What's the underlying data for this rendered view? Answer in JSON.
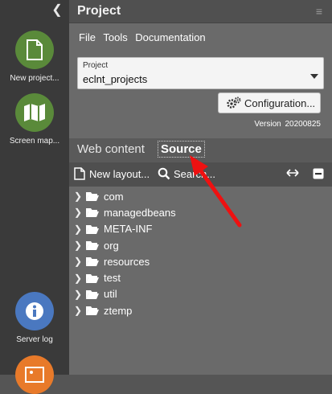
{
  "sidebar": {
    "collapse_icon": "chevron-left-icon",
    "items": [
      {
        "label": "New project...",
        "icon": "document-icon",
        "color": "#5a8a3a"
      },
      {
        "label": "Screen map...",
        "icon": "map-icon",
        "color": "#5a8a3a"
      },
      {
        "label": "Server log",
        "icon": "info-icon",
        "color": "#4a78c0"
      },
      {
        "label": "",
        "icon": "image-icon",
        "color": "#e87a2a"
      }
    ]
  },
  "panel": {
    "title": "Project",
    "menu": [
      "File",
      "Tools",
      "Documentation"
    ],
    "project_select": {
      "label": "Project",
      "value": "eclnt_projects"
    },
    "config_button": "Configuration...",
    "version_label": "Version",
    "version_value": "20200825",
    "tabs": [
      {
        "label": "Web content",
        "active": false
      },
      {
        "label": "Source",
        "active": true
      }
    ],
    "toolbar": {
      "new_layout": "New layout...",
      "search": "Search..."
    },
    "tree": [
      "com",
      "managedbeans",
      "META-INF",
      "org",
      "resources",
      "test",
      "util",
      "ztemp"
    ]
  },
  "colors": {
    "annotation_arrow": "#ee1111",
    "sidebar_bg": "#3a3a3a",
    "panel_bg": "#6a6a6a"
  }
}
